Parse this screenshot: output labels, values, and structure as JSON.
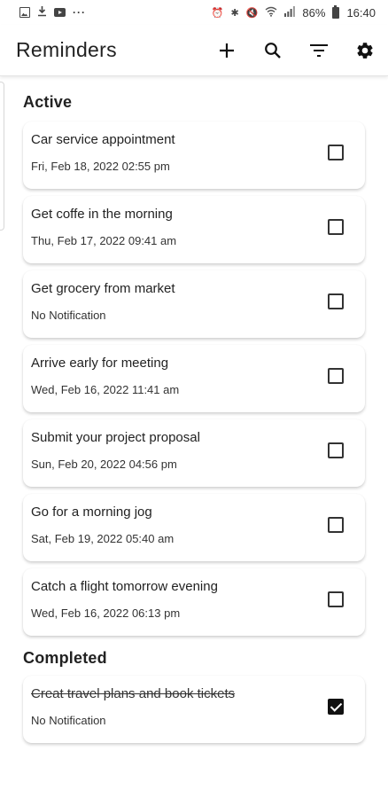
{
  "status_bar": {
    "left_icons": [
      "image-icon",
      "download-icon",
      "youtube-icon",
      "more-dots-icon"
    ],
    "battery": "86%",
    "time": "16:40"
  },
  "app_bar": {
    "title": "Reminders",
    "actions": [
      "add-icon",
      "search-icon",
      "filter-icon",
      "settings-icon"
    ]
  },
  "active": {
    "heading": "Active",
    "items": [
      {
        "title": "Car service appointment",
        "subtitle": "Fri, Feb 18, 2022  02:55 pm",
        "checked": false
      },
      {
        "title": "Get coffe in the morning",
        "subtitle": "Thu, Feb 17, 2022  09:41 am",
        "checked": false
      },
      {
        "title": "Get grocery from market",
        "subtitle": "No Notification",
        "checked": false
      },
      {
        "title": "Arrive early for meeting",
        "subtitle": "Wed, Feb 16, 2022  11:41 am",
        "checked": false
      },
      {
        "title": "Submit your project proposal",
        "subtitle": "Sun, Feb 20, 2022  04:56 pm",
        "checked": false
      },
      {
        "title": "Go for a morning jog",
        "subtitle": "Sat, Feb 19, 2022  05:40 am",
        "checked": false
      },
      {
        "title": "Catch a flight tomorrow evening",
        "subtitle": "Wed, Feb 16, 2022  06:13 pm",
        "checked": false
      }
    ]
  },
  "completed": {
    "heading": "Completed",
    "items": [
      {
        "title": "Creat travel plans and book tickets",
        "subtitle": "No Notification",
        "checked": true
      }
    ]
  }
}
